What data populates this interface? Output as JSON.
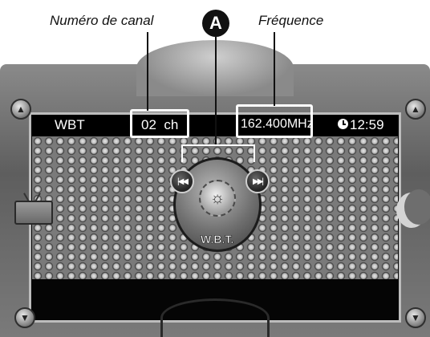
{
  "callouts": {
    "channel_label": "Numéro de canal",
    "marker": "A",
    "frequency_label": "Fréquence"
  },
  "status_bar": {
    "mode": "WBT",
    "channel": "02  ch",
    "frequency": "162.400MHz",
    "clock": "12:59"
  },
  "player": {
    "brand": "W.B.T."
  },
  "icons": {
    "prev": "skip-back-icon",
    "next": "skip-forward-icon",
    "tv": "tv-icon",
    "moon": "moon-icon",
    "clock": "clock-icon",
    "sun": "sun-icon",
    "up": "chevron-up-icon",
    "down": "chevron-down-icon"
  },
  "colors": {
    "screen_background": "#000000",
    "frame": "#7a7a7a",
    "highlight_box": "#ffffff"
  }
}
